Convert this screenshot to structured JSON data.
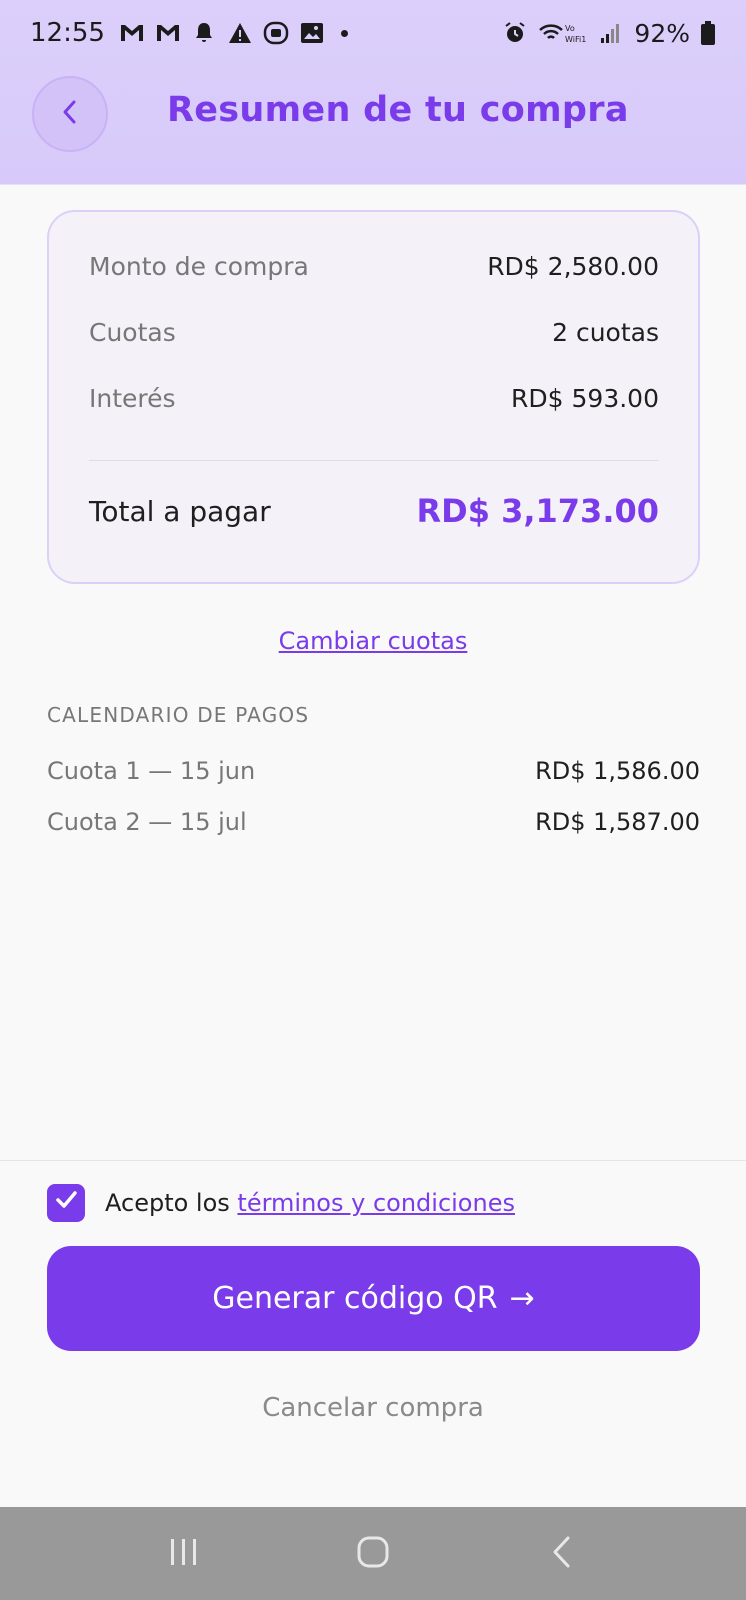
{
  "status_bar": {
    "time": "12:55",
    "battery": "92%",
    "icons": [
      "gmail-icon",
      "gmail-icon",
      "notification-bell-icon",
      "warning-icon",
      "media-icon",
      "image-icon",
      "dot-icon",
      "alarm-icon",
      "wifi-calling-icon",
      "signal-icon",
      "battery-icon"
    ]
  },
  "header": {
    "title": "Resumen de tu compra",
    "back_icon": "chevron-left-icon"
  },
  "summary": {
    "rows": [
      {
        "label": "Monto de compra",
        "value": "RD$ 2,580.00"
      },
      {
        "label": "Cuotas",
        "value": "2 cuotas"
      },
      {
        "label": "Interés",
        "value": "RD$ 593.00"
      }
    ],
    "total_label": "Total a pagar",
    "total_value": "RD$ 3,173.00"
  },
  "change_link": "Cambiar cuotas",
  "schedule": {
    "title": "CALENDARIO DE PAGOS",
    "items": [
      {
        "label": "Cuota 1 — 15 jun",
        "value": "RD$ 1,586.00"
      },
      {
        "label": "Cuota 2 — 15 jul",
        "value": "RD$ 1,587.00"
      }
    ]
  },
  "terms": {
    "prefix": "Acepto los",
    "link": "términos y condiciones",
    "checked": true
  },
  "qr_button": {
    "label": "Generar código QR",
    "arrow": "→"
  },
  "cancel_label": "Cancelar compra",
  "colors": {
    "accent": "#7a3bea",
    "header_bg": "#dccffb",
    "card_bg": "#f4f1f9",
    "nav_bg": "#999999"
  }
}
